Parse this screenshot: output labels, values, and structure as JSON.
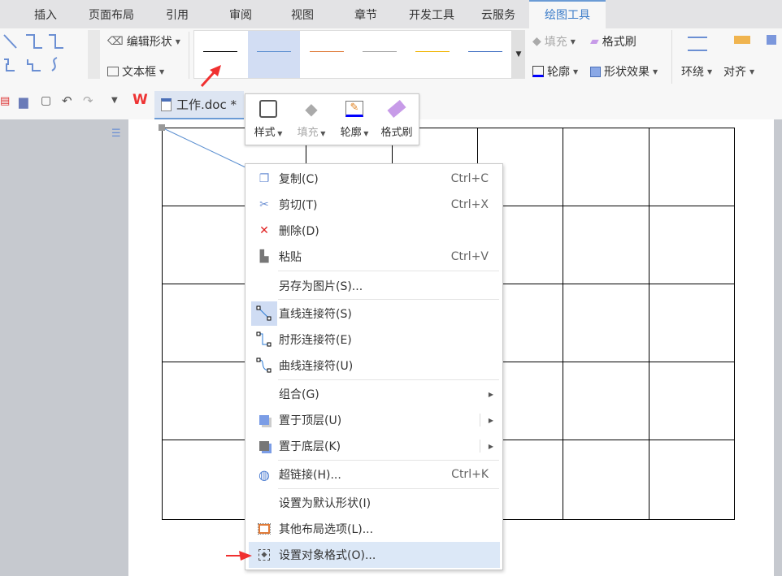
{
  "tabs": [
    "插入",
    "页面布局",
    "引用",
    "审阅",
    "视图",
    "章节",
    "开发工具",
    "云服务",
    "绘图工具"
  ],
  "active_tab": "绘图工具",
  "ribbon": {
    "edit_shape": "编辑形状",
    "text_box": "文本框",
    "fill": "填充",
    "format_painter": "格式刷",
    "outline": "轮廓",
    "shape_effects": "形状效果",
    "wrap": "环绕",
    "align": "对齐"
  },
  "line_styles": [
    "#000000",
    "#5b8fd0",
    "#e07b39",
    "#a5a5a5",
    "#f0b400",
    "#4472c4"
  ],
  "selected_line_style": 1,
  "document_tab": {
    "title": "工作.doc *"
  },
  "mini_toolbar": {
    "style": "样式",
    "fill": "填充",
    "outline": "轮廓",
    "format_painter": "格式刷"
  },
  "context_menu": [
    {
      "label": "复制(C)",
      "shortcut": "Ctrl+C",
      "icon": "copy-icon"
    },
    {
      "label": "剪切(T)",
      "shortcut": "Ctrl+X",
      "icon": "scissors-icon"
    },
    {
      "label": "删除(D)",
      "shortcut": "",
      "icon": "delete-icon"
    },
    {
      "label": "粘贴",
      "shortcut": "Ctrl+V",
      "icon": "paste-icon"
    },
    {
      "label": "另存为图片(S)...",
      "shortcut": "",
      "icon": ""
    },
    {
      "label": "直线连接符(S)",
      "shortcut": "",
      "icon": "straight-connector-icon"
    },
    {
      "label": "肘形连接符(E)",
      "shortcut": "",
      "icon": "elbow-connector-icon"
    },
    {
      "label": "曲线连接符(U)",
      "shortcut": "",
      "icon": "curved-connector-icon"
    },
    {
      "label": "组合(G)",
      "shortcut": "",
      "icon": ""
    },
    {
      "label": "置于顶层(U)",
      "shortcut": "",
      "icon": "bring-to-front-icon"
    },
    {
      "label": "置于底层(K)",
      "shortcut": "",
      "icon": "send-to-back-icon"
    },
    {
      "label": "超链接(H)...",
      "shortcut": "Ctrl+K",
      "icon": "hyperlink-icon"
    },
    {
      "label": "设置为默认形状(I)",
      "shortcut": "",
      "icon": ""
    },
    {
      "label": "其他布局选项(L)...",
      "shortcut": "",
      "icon": "layout-options-icon"
    },
    {
      "label": "设置对象格式(O)...",
      "shortcut": "",
      "icon": "format-object-icon"
    }
  ],
  "colors": {
    "accent": "#3b7cc9",
    "highlight": "#dce8f7",
    "arrow": "#f03030"
  }
}
